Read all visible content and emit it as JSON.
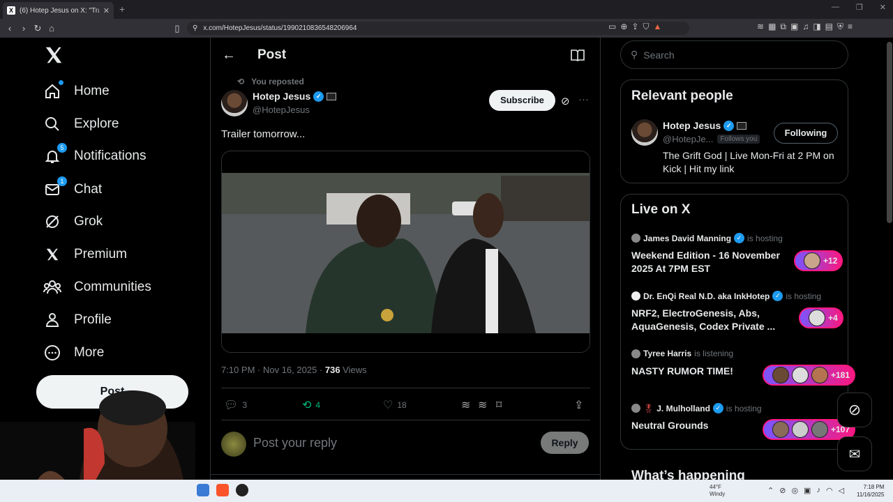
{
  "browser": {
    "tab_title": "(6) Hotep Jesus on X: \"Trailer tom",
    "url": "x.com/HotepJesus/status/1990210836548206964"
  },
  "nav": {
    "items": [
      {
        "label": "Home",
        "icon": "home-icon"
      },
      {
        "label": "Explore",
        "icon": "search-icon"
      },
      {
        "label": "Notifications",
        "icon": "bell-icon",
        "badge": "5"
      },
      {
        "label": "Chat",
        "icon": "mail-icon",
        "badge": "1"
      },
      {
        "label": "Grok",
        "icon": "grok-icon"
      },
      {
        "label": "Premium",
        "icon": "x-icon"
      },
      {
        "label": "Communities",
        "icon": "communities-icon"
      },
      {
        "label": "Profile",
        "icon": "person-icon"
      },
      {
        "label": "More",
        "icon": "more-circle-icon"
      }
    ],
    "post_button": "Post"
  },
  "post": {
    "header_title": "Post",
    "reposted_label": "You reposted",
    "author_name": "Hotep Jesus",
    "author_handle": "@HotepJesus",
    "subscribe_label": "Subscribe",
    "text": "Trailer tomorrow...",
    "time": "7:10 PM · Nov 16, 2025 · ",
    "views_count": "736",
    "views_label": " Views",
    "reply_count": "3",
    "repost_count": "4",
    "like_count": "18",
    "reply_placeholder": "Post your reply",
    "reply_button": "Reply"
  },
  "sidebar": {
    "search_placeholder": "Search",
    "relevant_title": "Relevant people",
    "relevant_person": {
      "name": "Hotep Jesus",
      "handle": "@HotepJe...",
      "follows_you": "Follows you",
      "button": "Following",
      "bio": "The Grift God | Live Mon-Fri at 2 PM on Kick | Hit my link"
    },
    "live_title": "Live on X",
    "live": [
      {
        "host": "James David Manning",
        "status": "is hosting",
        "title": "Weekend Edition - 16 November 2025 At 7PM EST",
        "count": "+12"
      },
      {
        "host": "Dr. EnQi Real N.D. aka InkHotep",
        "status": "is hosting",
        "title": "NRF2, ElectroGenesis, Abs, AquaGenesis, Codex Private ...",
        "count": "+4"
      },
      {
        "host": "Tyree Harris",
        "status": "is listening",
        "title": "NASTY RUMOR TIME!",
        "count": "+181"
      },
      {
        "host": "J. Mulholland",
        "status": "is hosting",
        "title": "Neutral Grounds",
        "count": "+107"
      }
    ],
    "whats_happening": "What’s happening"
  },
  "taskbar": {
    "temp": "44°F",
    "weather": "Windy",
    "time": "7:18 PM",
    "date": "11/16/2025"
  }
}
